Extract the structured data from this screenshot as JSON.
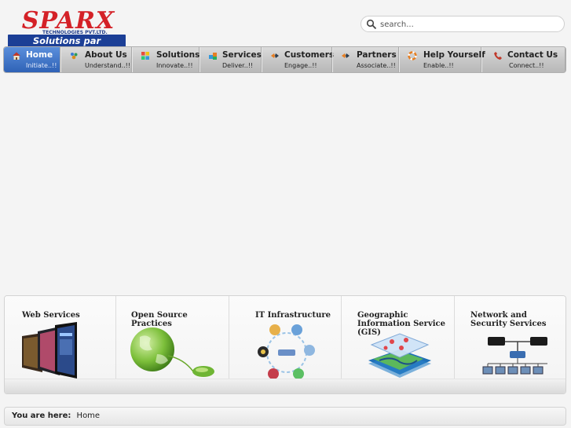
{
  "logo": {
    "brand": "SPARX",
    "company": "TECHNOLOGIES PVT.LTD.",
    "tagline": "Solutions par excellence"
  },
  "search": {
    "placeholder": "search..."
  },
  "nav": [
    {
      "label": "Home",
      "sub": "Initiate..!!",
      "icon": "home-icon",
      "active": true
    },
    {
      "label": "About Us",
      "sub": "Understand..!!",
      "icon": "people-icon"
    },
    {
      "label": "Solutions",
      "sub": "Innovate..!!",
      "icon": "puzzle-icon"
    },
    {
      "label": "Services",
      "sub": "Deliver..!!",
      "icon": "cubes-icon"
    },
    {
      "label": "Customers",
      "sub": "Engage..!!",
      "icon": "handshake-icon"
    },
    {
      "label": "Partners",
      "sub": "Associate..!!",
      "icon": "handshake-icon"
    },
    {
      "label": "Help Yourself",
      "sub": "Enable..!!",
      "icon": "lifebuoy-icon"
    },
    {
      "label": "Contact Us",
      "sub": "Connect..!!",
      "icon": "phone-icon"
    }
  ],
  "services": [
    {
      "title": "Web Services",
      "image": "web-screens-image"
    },
    {
      "title": "Open Source Practices",
      "image": "globe-mouse-image"
    },
    {
      "title": "IT Infrastructure",
      "image": "infrastructure-cycle-image"
    },
    {
      "title": "Geographic Information Service (GIS)",
      "image": "gis-layers-image"
    },
    {
      "title": "Network and Security Services",
      "image": "network-diagram-image"
    }
  ],
  "breadcrumb": {
    "label": "You are here:",
    "current": "Home"
  },
  "colors": {
    "brand_red": "#d42127",
    "brand_blue": "#1c3f96",
    "nav_active": "#3f73c8"
  }
}
